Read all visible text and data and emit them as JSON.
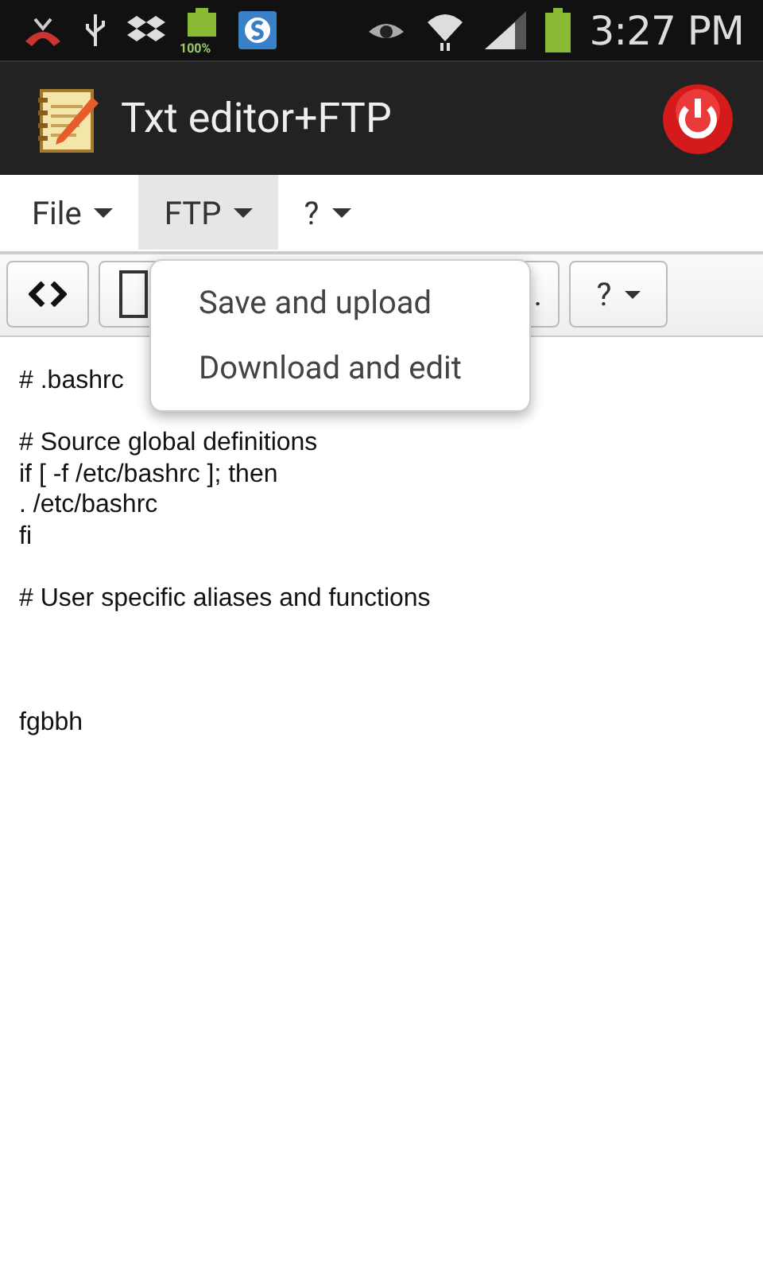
{
  "status_bar": {
    "battery_label": "100%",
    "time": "3:27 PM"
  },
  "app_bar": {
    "title": "Txt editor+FTP"
  },
  "menus": [
    {
      "label": "File",
      "selected": false
    },
    {
      "label": "FTP",
      "selected": true
    },
    {
      "label": "?",
      "selected": false
    }
  ],
  "toolbar": [
    {
      "kind": "code"
    },
    {
      "kind": "square"
    },
    {
      "kind": "text",
      "label": "."
    },
    {
      "kind": "menu",
      "label": "?"
    }
  ],
  "popup": {
    "items": [
      "Save and upload",
      "Download and edit"
    ]
  },
  "editor": {
    "text": "# .bashrc\n\n# Source global definitions\nif [ -f /etc/bashrc ]; then\n. /etc/bashrc\nfi\n\n# User specific aliases and functions\n\n\n\nfgbbh"
  }
}
